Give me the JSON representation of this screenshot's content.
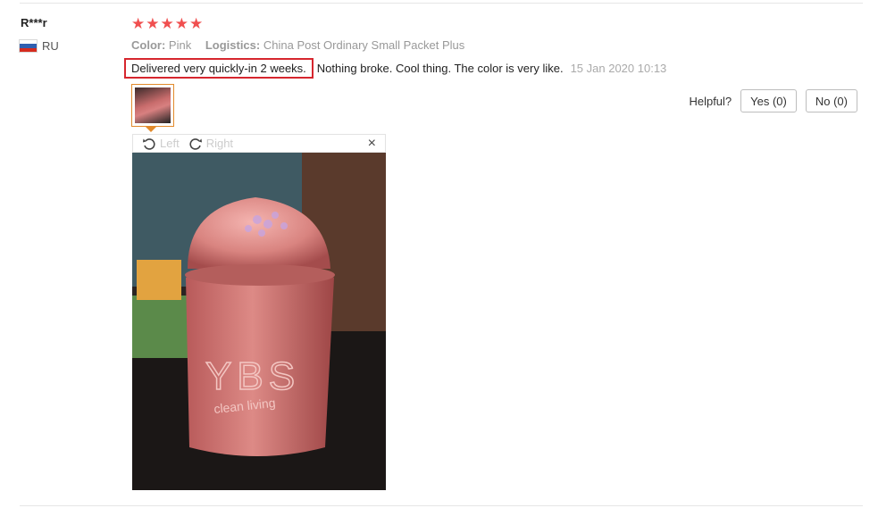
{
  "reviewer": {
    "name": "R***r",
    "country_code": "RU",
    "flag_colors": [
      "#ffffff",
      "#2f5fb0",
      "#d52b1e"
    ]
  },
  "rating": {
    "stars": 5,
    "max": 5,
    "color": "#f04f4f"
  },
  "meta": {
    "color_label": "Color:",
    "color_value": "Pink",
    "logistics_label": "Logistics:",
    "logistics_value": "China Post Ordinary Small Packet Plus"
  },
  "review": {
    "highlighted_text": "Delivered very quickly-in 2 weeks.",
    "rest_text": "Nothing broke. Cool thing. The color is very like.",
    "date": "15 Jan 2020 10:13",
    "highlight_color": "#d6262e"
  },
  "helpful": {
    "label": "Helpful?",
    "yes_label": "Yes (0)",
    "no_label": "No (0)"
  },
  "viewer": {
    "rotate_left_label": "Left",
    "rotate_right_label": "Right",
    "close_symbol": "×"
  },
  "photo": {
    "brand_text": "YBS",
    "tagline": "clean living"
  }
}
